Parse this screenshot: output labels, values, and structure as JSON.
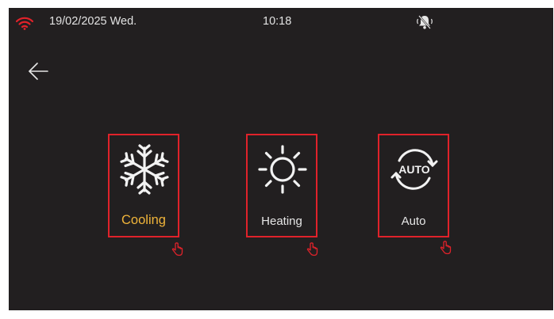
{
  "status_bar": {
    "date": "19/02/2025 Wed.",
    "time": "10:18",
    "wifi_icon": "wifi-icon",
    "bell_icon": "bell-muted-icon",
    "wifi_color": "#e0222a"
  },
  "nav": {
    "back_icon": "back-arrow-icon"
  },
  "modes": [
    {
      "label": "Cooling",
      "icon": "snowflake-icon",
      "selected": true
    },
    {
      "label": "Heating",
      "icon": "sun-icon",
      "selected": false
    },
    {
      "label": "Auto",
      "icon": "auto-cycle-icon",
      "icon_text": "AUTO",
      "selected": false
    }
  ],
  "colors": {
    "background": "#221f20",
    "highlight_border": "#e0222a",
    "selected_text": "#f0b43a",
    "text": "#e6e6e6"
  }
}
